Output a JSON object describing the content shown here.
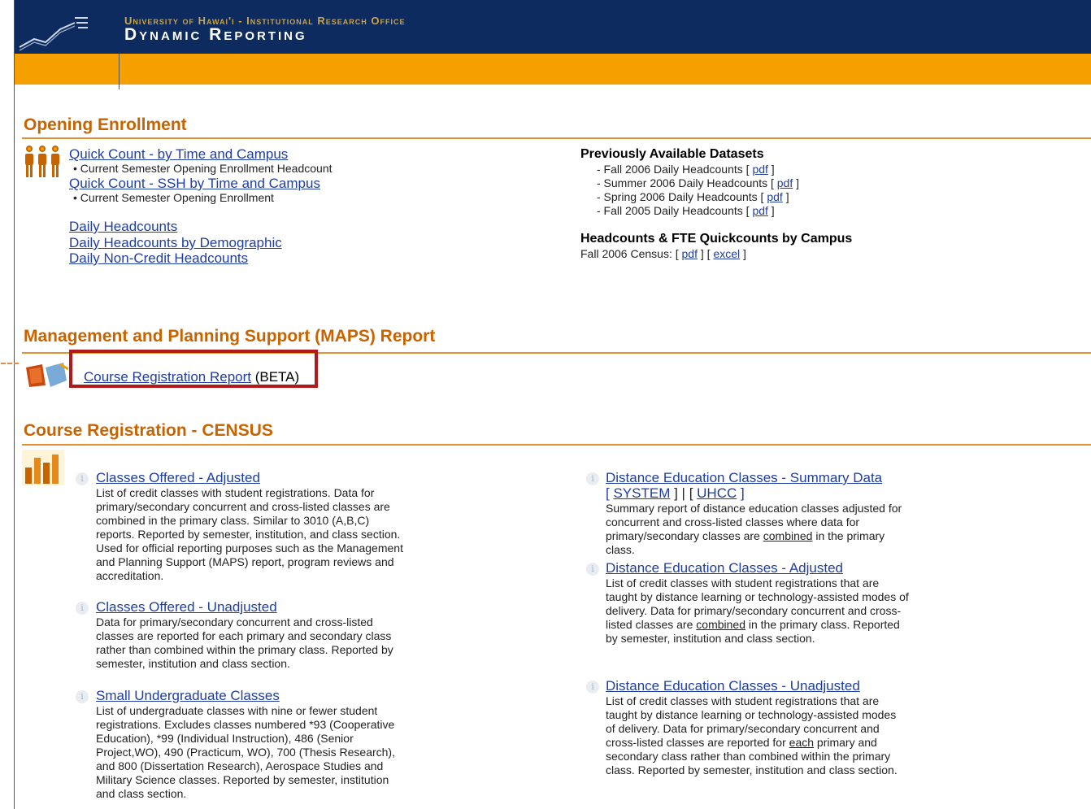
{
  "header": {
    "sup_title": "University of Hawai'i - Institutional Research Office",
    "title": "Dynamic Reporting"
  },
  "opening": {
    "title": "Opening Enrollment",
    "links": [
      {
        "label": "Quick Count - by Time and Campus",
        "desc": "• Current Semester Opening Enrollment Headcount"
      },
      {
        "label": "Quick Count - SSH by Time and Campus",
        "desc": "• Current Semester Opening Enrollment"
      }
    ],
    "daily": [
      "Daily Headcounts",
      "Daily Headcounts by Demographic",
      "Daily Non-Credit Headcounts"
    ],
    "prev": {
      "heading": "Previously Available Datasets",
      "items": [
        {
          "text": "- Fall 2006 Daily Headcounts [",
          "link": "pdf",
          "close": "]"
        },
        {
          "text": "- Summer 2006 Daily Headcounts [",
          "link": "pdf",
          "close": "]"
        },
        {
          "text": "- Spring 2006 Daily Headcounts [",
          "link": "pdf",
          "close": "]"
        },
        {
          "text": "- Fall 2005 Daily Headcounts [",
          "link": "pdf",
          "close": "]"
        }
      ]
    },
    "fte": {
      "heading": "Headcounts & FTE Quickcounts by Campus",
      "census_label": "Fall 2006 Census: [",
      "pdf": "pdf",
      "mid": "] [",
      "excel": "excel",
      "close": "]"
    }
  },
  "maps": {
    "title": "Management and Planning Support (MAPS) Report",
    "link": "Course Registration Report",
    "suffix": "(BETA)"
  },
  "census": {
    "title": "Course Registration - CENSUS",
    "left": [
      {
        "title": "Classes Offered - Adjusted",
        "desc": "List of credit classes with student registrations. Data for primary/secondary concurrent and cross-listed classes are combined in the primary class. Similar to 3010 (A,B,C) reports. Reported by semester, institution, and class section. Used for official reporting purposes such as the Management and Planning Support (MAPS) report, program reviews and accreditation."
      },
      {
        "title": "Classes Offered - Unadjusted",
        "desc": "Data for primary/secondary concurrent and cross-listed classes are reported for each primary and secondary class rather than combined within the primary class. Reported by semester, institution and class section."
      },
      {
        "title": "Small Undergraduate Classes",
        "desc": "List of undergraduate classes with nine or fewer student registrations. Excludes classes numbered *93 (Cooperative Education), *99 (Individual Instruction), 486 (Senior Project,WO), 490 (Practicum, WO), 700 (Thesis Research), and 800 (Dissertation Research), Aerospace Studies and Military Science classes. Reported by semester, institution and class section."
      }
    ],
    "right": {
      "summary": {
        "title": "Distance Education Classes - Summary Data",
        "open1": "[",
        "system": "SYSTEM",
        "between": "] | [",
        "uhcc": "UHCC",
        "close": "]",
        "desc_a": "Summary report of distance education classes adjusted for concurrent and cross-listed classes where data for primary/secondary classes are",
        "desc_u": "combined",
        "desc_b": "in the primary class."
      },
      "adjusted": {
        "title": "Distance Education Classes - Adjusted",
        "desc_a": "List of credit classes with student registrations that are taught by distance learning or technology-assisted modes of delivery. Data for primary/secondary concurrent and cross-listed classes are",
        "desc_u": "combined",
        "desc_b": "in the primary class. Reported by semester, institution and class section."
      },
      "unadjusted": {
        "title": "Distance Education Classes - Unadjusted",
        "desc_a": "List of credit classes with student registrations that are taught by distance learning or technology-assisted modes of delivery. Data for primary/secondary concurrent and cross-listed classes are reported for",
        "desc_u": "each",
        "desc_b": "primary and secondary class rather than combined within the primary class. Reported by semester, institution and class section."
      }
    }
  },
  "colors": {
    "navy": "#0d2b5e",
    "orange": "#f5a000",
    "section": "#c86400",
    "link": "#1f3e9e",
    "highlight": "#b01a1a"
  },
  "icons": [
    "chart-logo-icon",
    "people-icon",
    "maps-report-icon",
    "bar-chart-icon",
    "info-icon"
  ]
}
